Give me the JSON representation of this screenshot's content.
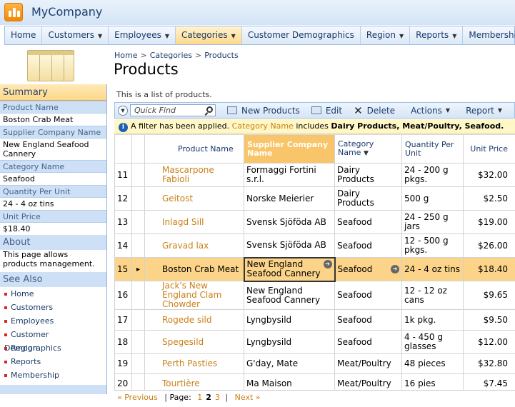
{
  "app": {
    "title": "MyCompany"
  },
  "nav": [
    {
      "label": "Home",
      "dropdown": false,
      "active": false
    },
    {
      "label": "Customers",
      "dropdown": true,
      "active": false
    },
    {
      "label": "Employees",
      "dropdown": true,
      "active": false
    },
    {
      "label": "Categories",
      "dropdown": true,
      "active": true
    },
    {
      "label": "Customer Demographics",
      "dropdown": false,
      "active": false
    },
    {
      "label": "Region",
      "dropdown": true,
      "active": false
    },
    {
      "label": "Reports",
      "dropdown": true,
      "active": false
    },
    {
      "label": "Membership",
      "dropdown": false,
      "active": false
    }
  ],
  "breadcrumb": [
    "Home",
    "Categories",
    "Products"
  ],
  "page": {
    "title": "Products",
    "description": "This is a list of products."
  },
  "sidebar": {
    "summary_title": "Summary",
    "summary": [
      {
        "label": "Product Name",
        "value": "Boston Crab Meat"
      },
      {
        "label": "Supplier Company Name",
        "value": "New England Seafood Cannery"
      },
      {
        "label": "Category Name",
        "value": "Seafood"
      },
      {
        "label": "Quantity Per Unit",
        "value": "24 - 4 oz tins"
      },
      {
        "label": "Unit Price",
        "value": "$18.40"
      }
    ],
    "about_title": "About",
    "about_text": "This page allows products management.",
    "see_also_title": "See Also",
    "links": [
      "Home",
      "Customers",
      "Employees",
      "Customer Demographics",
      "Region",
      "Reports",
      "Membership"
    ]
  },
  "toolbar": {
    "quick_find_placeholder": "Quick Find",
    "new_label": "New Products",
    "edit_label": "Edit",
    "delete_label": "Delete",
    "actions_label": "Actions",
    "report_label": "Report"
  },
  "filter": {
    "prefix": "A filter has been applied.",
    "field": "Category Name",
    "middle": "includes",
    "values": "Dairy Products, Meat/Poultry, Seafood."
  },
  "grid": {
    "headers": {
      "product": "Product Name",
      "supplier": "Supplier Company Name",
      "category": "Category Name",
      "quantity": "Quantity Per Unit",
      "price": "Unit Price"
    },
    "rows": [
      {
        "num": "11",
        "product": "Mascarpone Fabioli",
        "supplier": "Formaggi Fortini s.r.l.",
        "category": "Dairy Products",
        "quantity": "24 - 200 g pkgs.",
        "price": "$32.00",
        "selected": false
      },
      {
        "num": "12",
        "product": "Geitost",
        "supplier": "Norske Meierier",
        "category": "Dairy Products",
        "quantity": "500 g",
        "price": "$2.50",
        "selected": false
      },
      {
        "num": "13",
        "product": "Inlagd Sill",
        "supplier": "Svensk Sjöföda AB",
        "category": "Seafood",
        "quantity": "24 - 250 g jars",
        "price": "$19.00",
        "selected": false
      },
      {
        "num": "14",
        "product": "Gravad lax",
        "supplier": "Svensk Sjöföda AB",
        "category": "Seafood",
        "quantity": "12 - 500 g pkgs.",
        "price": "$26.00",
        "selected": false
      },
      {
        "num": "15",
        "product": "Boston Crab Meat",
        "supplier": "New England Seafood Cannery",
        "category": "Seafood",
        "quantity": "24 - 4 oz tins",
        "price": "$18.40",
        "selected": true
      },
      {
        "num": "16",
        "product": "Jack's New England Clam Chowder",
        "supplier": "New England Seafood Cannery",
        "category": "Seafood",
        "quantity": "12 - 12 oz cans",
        "price": "$9.65",
        "selected": false
      },
      {
        "num": "17",
        "product": "Rogede sild",
        "supplier": "Lyngbysild",
        "category": "Seafood",
        "quantity": "1k pkg.",
        "price": "$9.50",
        "selected": false
      },
      {
        "num": "18",
        "product": "Spegesild",
        "supplier": "Lyngbysild",
        "category": "Seafood",
        "quantity": "4 - 450 g glasses",
        "price": "$12.00",
        "selected": false
      },
      {
        "num": "19",
        "product": "Perth Pasties",
        "supplier": "G'day, Mate",
        "category": "Meat/Poultry",
        "quantity": "48 pieces",
        "price": "$32.80",
        "selected": false
      },
      {
        "num": "20",
        "product": "Tourtière",
        "supplier": "Ma Maison",
        "category": "Meat/Poultry",
        "quantity": "16 pies",
        "price": "$7.45",
        "selected": false
      }
    ]
  },
  "pager": {
    "previous": "« Previous",
    "page_label": "Page:",
    "pages": [
      "1",
      "2",
      "3"
    ],
    "current": "2",
    "next": "Next »"
  },
  "colors": {
    "accent": "#f9c56a",
    "link": "#c9811a",
    "nav_text": "#1b3a6a"
  }
}
